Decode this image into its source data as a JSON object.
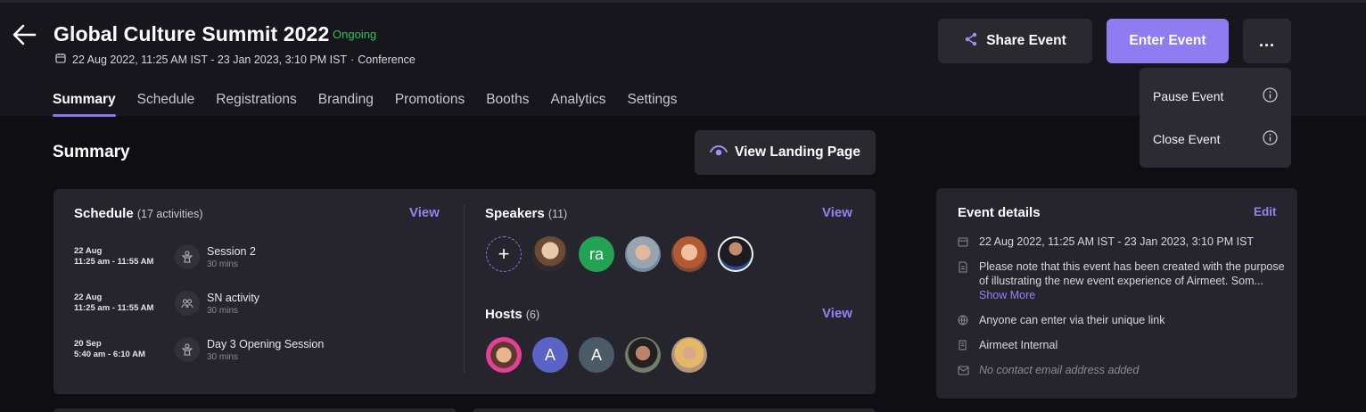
{
  "header": {
    "title": "Global Culture Summit 2022",
    "status": "Ongoing",
    "date_range": "22 Aug 2022, 11:25 AM IST - 23 Jan 2023, 3:10 PM IST",
    "separator": "·",
    "event_type": "Conference"
  },
  "tabs": [
    "Summary",
    "Schedule",
    "Registrations",
    "Branding",
    "Promotions",
    "Booths",
    "Analytics",
    "Settings"
  ],
  "actions": {
    "share_label": "Share Event",
    "enter_label": "Enter Event",
    "more_label": "..."
  },
  "dropdown": {
    "pause_label": "Pause Event",
    "close_label": "Close Event"
  },
  "summary": {
    "title": "Summary",
    "landing_label": "View Landing Page"
  },
  "schedule": {
    "title": "Schedule",
    "count": "(17 activities)",
    "view_label": "View",
    "activities": [
      {
        "date": "22 Aug",
        "time": "11:25 am - 11:55 AM",
        "name": "Session 2",
        "duration": "30 mins",
        "icon": "session-icon"
      },
      {
        "date": "22 Aug",
        "time": "11:25 am - 11:55 AM",
        "name": "SN activity",
        "duration": "30 mins",
        "icon": "networking-icon"
      },
      {
        "date": "20 Sep",
        "time": "5:40 am - 6:10 AM",
        "name": "Day 3 Opening Session",
        "duration": "30 mins",
        "icon": "session-icon"
      }
    ]
  },
  "speakers": {
    "title": "Speakers",
    "count": "(11)",
    "view_label": "View",
    "add_label": "+",
    "initials": "ra"
  },
  "hosts": {
    "title": "Hosts",
    "count": "(6)",
    "view_label": "View",
    "initials_1": "A",
    "initials_2": "A"
  },
  "details": {
    "title": "Event details",
    "edit_label": "Edit",
    "date_range": "22 Aug 2022, 11:25 AM IST - 23 Jan 2023, 3:10 PM IST",
    "description": "Please note that this event has been created with the purpose of illustrating the new event experience of Airmeet. Som...",
    "show_more": "Show More",
    "access": "Anyone can enter via their unique link",
    "organizer": "Airmeet Internal",
    "email": "No contact email address added"
  },
  "colors": {
    "accent": "#8f7cf1",
    "status_green": "#22c55e",
    "background": "#0f0e13",
    "card": "#26252d"
  }
}
